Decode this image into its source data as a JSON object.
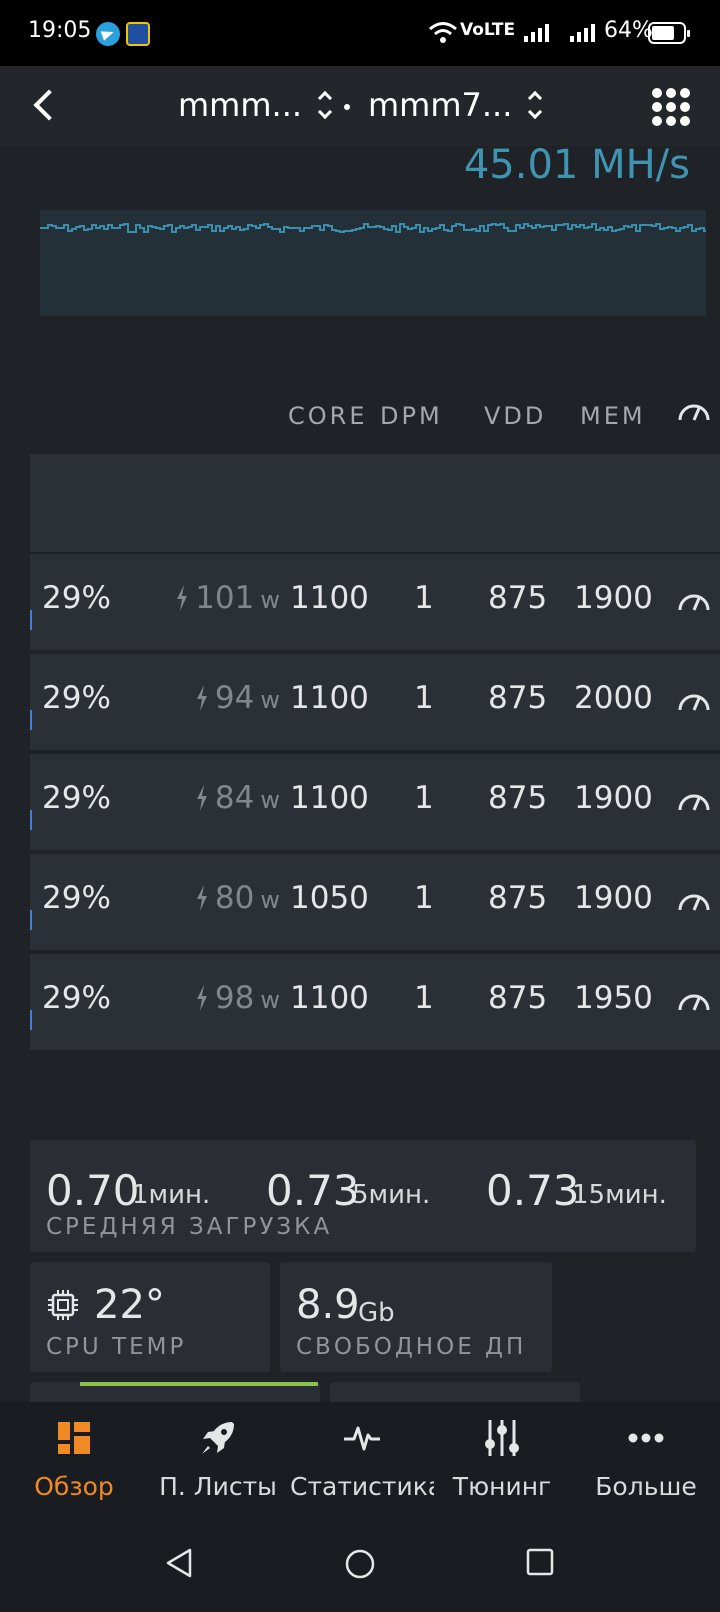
{
  "status_bar": {
    "time": "19:05",
    "network": "VoLTE",
    "battery": "64%"
  },
  "header": {
    "rig_selector": "mmm...",
    "worker_selector": "mmm7..."
  },
  "hashrate": {
    "value": "45.01 MH/s"
  },
  "gpu_table": {
    "columns": [
      "CORE",
      "DPM",
      "VDD",
      "MEM"
    ],
    "rows": [
      {
        "fan": "29%",
        "power": "101",
        "power_unit": "w",
        "core": "1100",
        "dpm": "1",
        "vdd": "875",
        "mem": "1900"
      },
      {
        "fan": "29%",
        "power": "94",
        "power_unit": "w",
        "core": "1100",
        "dpm": "1",
        "vdd": "875",
        "mem": "2000"
      },
      {
        "fan": "29%",
        "power": "84",
        "power_unit": "w",
        "core": "1100",
        "dpm": "1",
        "vdd": "875",
        "mem": "1900"
      },
      {
        "fan": "29%",
        "power": "80",
        "power_unit": "w",
        "core": "1050",
        "dpm": "1",
        "vdd": "875",
        "mem": "1900"
      },
      {
        "fan": "29%",
        "power": "98",
        "power_unit": "w",
        "core": "1100",
        "dpm": "1",
        "vdd": "875",
        "mem": "1950"
      }
    ]
  },
  "system": {
    "load_avg": {
      "caption": "СРЕДНЯЯ ЗАГРУЗКА",
      "items": [
        {
          "value": "0.70",
          "label": "1мин."
        },
        {
          "value": "0.73",
          "label": "5мин."
        },
        {
          "value": "0.73",
          "label": "15мин."
        }
      ]
    },
    "cpu_temp": {
      "value": "22°",
      "caption": "CPU TEMP"
    },
    "free_disk": {
      "value": "8.9",
      "unit": "Gb",
      "caption": "СВОБОДНОЕ ДП"
    }
  },
  "bottom_nav": [
    {
      "label": "Обзор",
      "icon": "overview-icon",
      "active": true
    },
    {
      "label": "П. Листы",
      "icon": "rocket-icon"
    },
    {
      "label": "Статистика",
      "icon": "pulse-icon"
    },
    {
      "label": "Тюнинг",
      "icon": "sliders-icon"
    },
    {
      "label": "Больше",
      "icon": "more-icon"
    }
  ],
  "colors": {
    "accent": "#f08a24",
    "hashrate": "#3f94b2",
    "good_bar": "#8bc34a",
    "background": "#1f2328"
  }
}
